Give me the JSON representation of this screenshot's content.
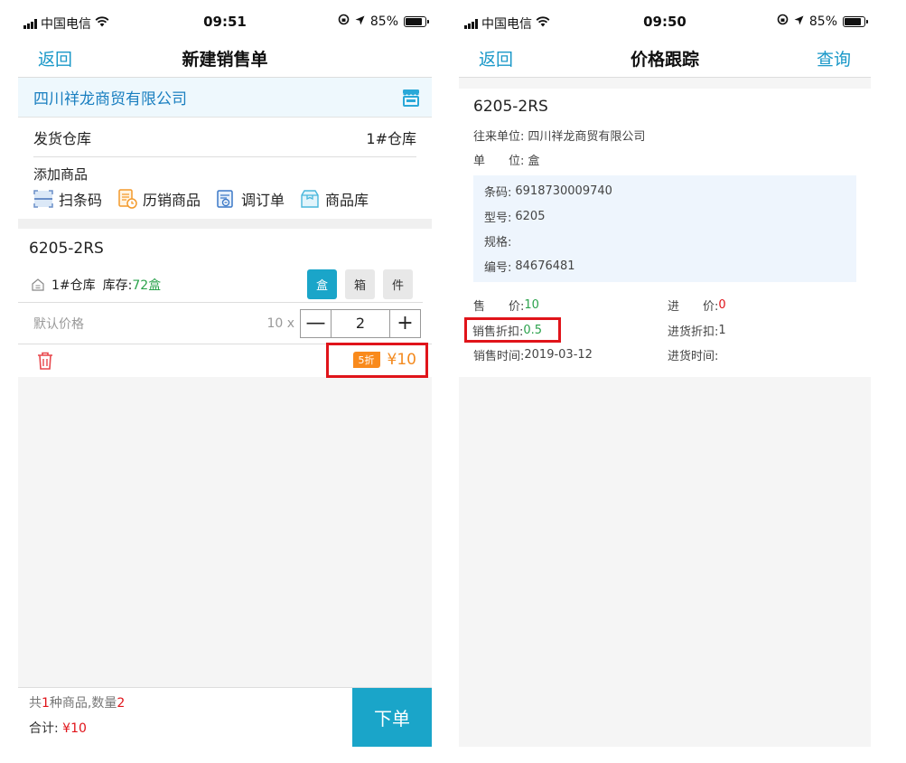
{
  "left": {
    "status": {
      "carrier": "中国电信",
      "time": "09:51",
      "battery": "85%"
    },
    "nav": {
      "back": "返回",
      "title": "新建销售单"
    },
    "customer": "四川祥龙商贸有限公司",
    "warehouse": {
      "label": "发货仓库",
      "value": "1#仓库"
    },
    "add_goods": {
      "title": "添加商品",
      "shortcuts": [
        "扫条码",
        "历销商品",
        "调订单",
        "商品库"
      ]
    },
    "item": {
      "code": "6205-2RS",
      "warehouse": "1#仓库",
      "stock_label": "库存:",
      "stock_qty": "72盒",
      "units": [
        "盒",
        "箱",
        "件"
      ],
      "price_label": "默认价格",
      "unit_price": "10 x",
      "quantity": "2",
      "minus": "—",
      "plus": "+",
      "discount": "5折",
      "total": "¥10"
    },
    "footer": {
      "prefix": "共",
      "kinds": "1",
      "middle": "种商品,数量",
      "qty": "2",
      "sum_label": "合计:",
      "sum_value": "¥10",
      "submit": "下单"
    }
  },
  "right": {
    "status": {
      "carrier": "中国电信",
      "time": "09:50",
      "battery": "85%"
    },
    "nav": {
      "back": "返回",
      "title": "价格跟踪",
      "action": "查询"
    },
    "code": "6205-2RS",
    "partner": {
      "k": "往来单位:",
      "v": "四川祥龙商贸有限公司"
    },
    "unit": {
      "k": "单　　位:",
      "v": "盒"
    },
    "info": [
      {
        "k": "条码:",
        "v": "6918730009740"
      },
      {
        "k": "型号:",
        "v": "6205"
      },
      {
        "k": "规格:",
        "v": ""
      },
      {
        "k": "编号:",
        "v": "84676481"
      }
    ],
    "sale_price": {
      "k": "售　　价:",
      "v": "10"
    },
    "purchase_price": {
      "k": "进　　价:",
      "v": "0"
    },
    "sale_discount": {
      "k": "销售折扣:",
      "v": "0.5"
    },
    "purchase_discount": {
      "k": "进货折扣:",
      "v": "1"
    },
    "sale_time": {
      "k": "销售时间:",
      "v": "2019-03-12"
    },
    "purchase_time": {
      "k": "进货时间:",
      "v": ""
    }
  },
  "colors": {
    "accent": "#1aa5c9",
    "link": "#1a98c8",
    "highlight": "#e0141a",
    "orange": "#f38a1f",
    "green": "#2ba24c"
  }
}
